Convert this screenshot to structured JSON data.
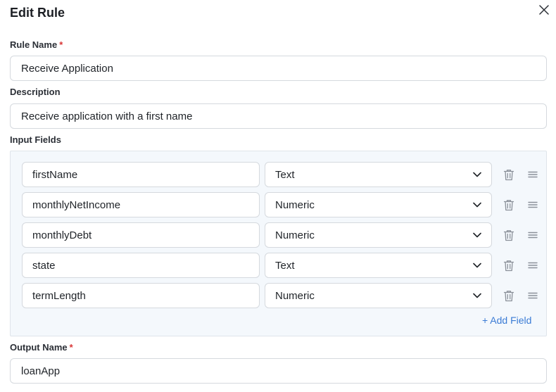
{
  "dialog": {
    "title": "Edit Rule"
  },
  "rule_name": {
    "label": "Rule Name",
    "required_mark": "*",
    "value": "Receive Application"
  },
  "description": {
    "label": "Description",
    "value": "Receive application with a first name"
  },
  "input_fields": {
    "label": "Input Fields",
    "rows": [
      {
        "name": "firstName",
        "type": "Text"
      },
      {
        "name": "monthlyNetIncome",
        "type": "Numeric"
      },
      {
        "name": "monthlyDebt",
        "type": "Numeric"
      },
      {
        "name": "state",
        "type": "Text"
      },
      {
        "name": "termLength",
        "type": "Numeric"
      }
    ],
    "add_label": "+ Add Field"
  },
  "output_name": {
    "label": "Output Name",
    "required_mark": "*",
    "value": "loanApp"
  },
  "icons": {
    "close": "close-icon",
    "delete": "trash-icon",
    "drag": "drag-handle-icon",
    "dropdown": "chevron-down-icon"
  },
  "colors": {
    "accent": "#3a7bd5",
    "required": "#d93636",
    "panel_bg": "#f4f8fc"
  }
}
